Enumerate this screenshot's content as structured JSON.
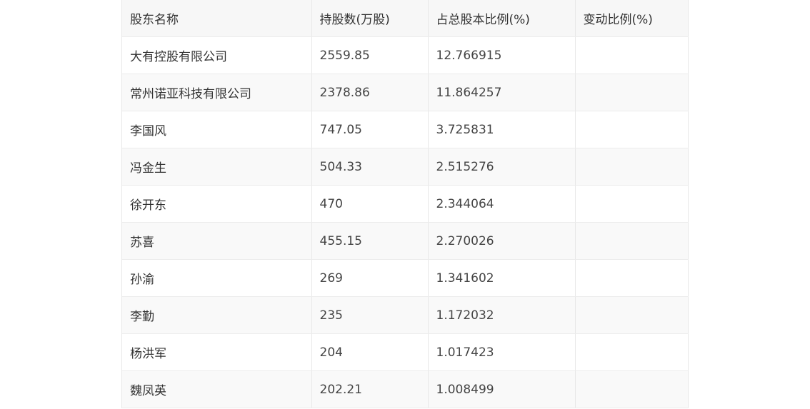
{
  "table": {
    "headers": [
      "股东名称",
      "持股数(万股)",
      "占总股本比例(%)",
      "变动比例(%)"
    ],
    "rows": [
      [
        "大有控股有限公司",
        "2559.85",
        "12.766915",
        ""
      ],
      [
        "常州诺亚科技有限公司",
        "2378.86",
        "11.864257",
        ""
      ],
      [
        "李国风",
        "747.05",
        "3.725831",
        ""
      ],
      [
        "冯金生",
        "504.33",
        "2.515276",
        ""
      ],
      [
        "徐开东",
        "470",
        "2.344064",
        ""
      ],
      [
        "苏喜",
        "455.15",
        "2.270026",
        ""
      ],
      [
        "孙渝",
        "269",
        "1.341602",
        ""
      ],
      [
        "李勤",
        "235",
        "1.172032",
        ""
      ],
      [
        "杨洪军",
        "204",
        "1.017423",
        ""
      ],
      [
        "魏凤英",
        "202.21",
        "1.008499",
        ""
      ]
    ]
  }
}
